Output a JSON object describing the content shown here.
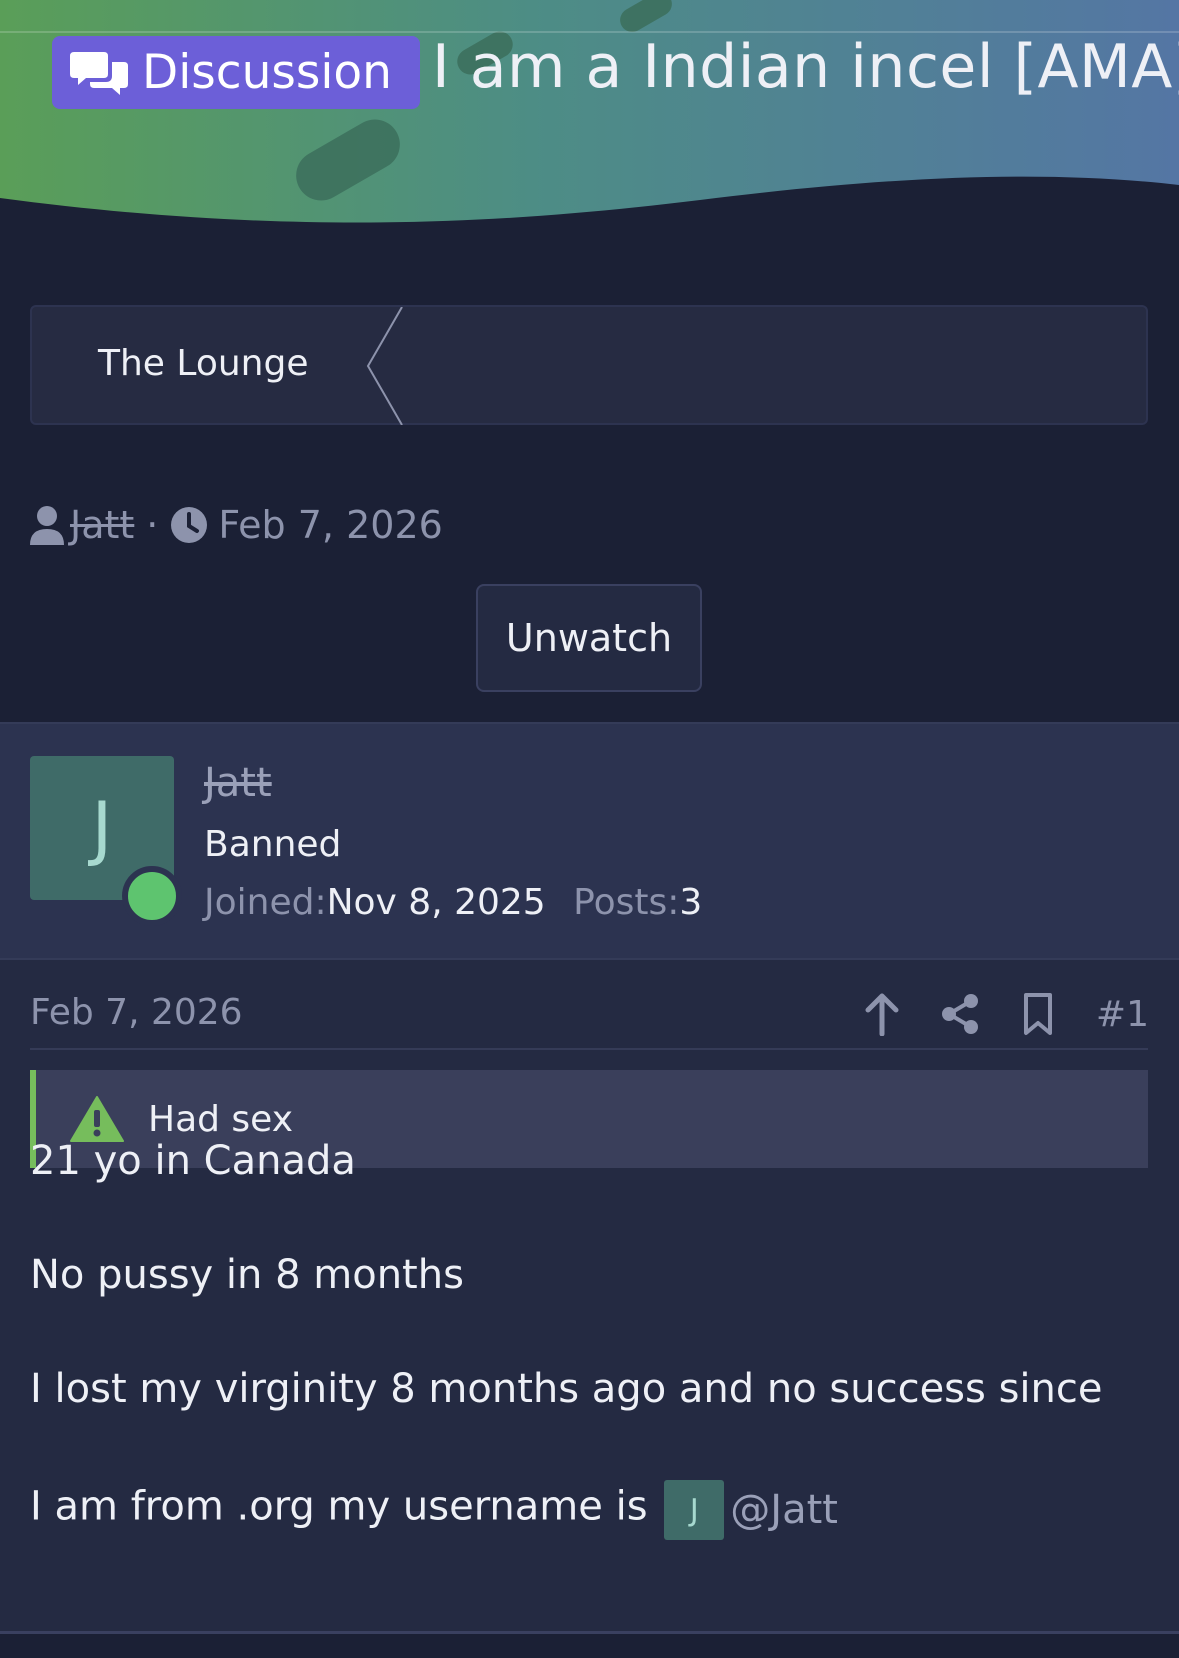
{
  "thread": {
    "prefix_label": "Discussion",
    "title": "I am a Indian incel [AMA]",
    "breadcrumb": "The Lounge",
    "author": "Jatt",
    "separator": "·",
    "date": "Feb 7, 2026",
    "watch_label": "Unwatch"
  },
  "post": {
    "avatar_letter": "J",
    "username": "Jatt",
    "user_title": "Banned",
    "joined_label": "Joined:",
    "joined_value": "Nov 8, 2025",
    "posts_label": "Posts:",
    "posts_value": "3",
    "date": "Feb 7, 2026",
    "number": "#1",
    "notice": "Had sex",
    "paragraphs": [
      "21 yo in Canada",
      "No pussy in 8 months",
      "I lost my virginity 8 months ago and no success since"
    ],
    "last_line_text": "I am from .org my username is",
    "mention_letter": "J",
    "mention": "@Jatt"
  },
  "colors": {
    "prefix_bg": "#6c5fd8",
    "online": "#5ec46f",
    "notice_accent": "#76bd5c",
    "avatar_bg": "#3f6b68"
  },
  "icons": [
    "comments-icon",
    "chevron-separator-icon",
    "user-icon",
    "clock-icon",
    "upvote-icon",
    "share-icon",
    "bookmark-icon",
    "warning-icon"
  ]
}
